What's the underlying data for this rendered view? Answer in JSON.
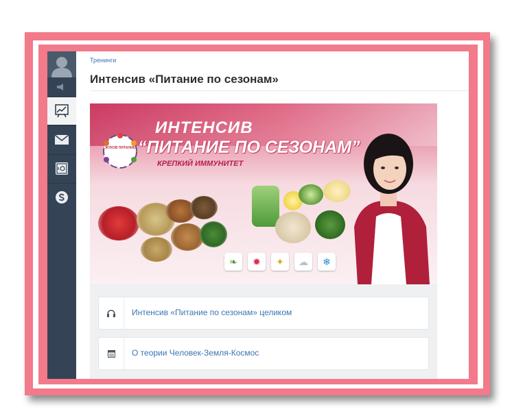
{
  "breadcrumb": "Тренинги",
  "page_title": "Интенсив «Питание по сезонам»",
  "banner": {
    "line1": "ИНТЕНСИВ",
    "line2": "“ПИТАНИЕ ПО СЕЗОНАМ”",
    "line3": "КРЕПКИЙ ИММУНИТЕТ",
    "logo_text": "ЖУКОВ ПИТАНИЕ"
  },
  "sidebar": {
    "items": [
      "profile-avatar",
      "collapse",
      "stats",
      "mail",
      "safe",
      "skype"
    ]
  },
  "lessons": [
    {
      "icon": "headphones-icon",
      "label": "Интенсив «Питание по сезонам» целиком"
    },
    {
      "icon": "document-icon",
      "label": "О теории Человек-Земля-Космос"
    }
  ],
  "colors": {
    "frame": "#f27a8a",
    "sidebar": "#344456",
    "link": "#3b73b5"
  }
}
